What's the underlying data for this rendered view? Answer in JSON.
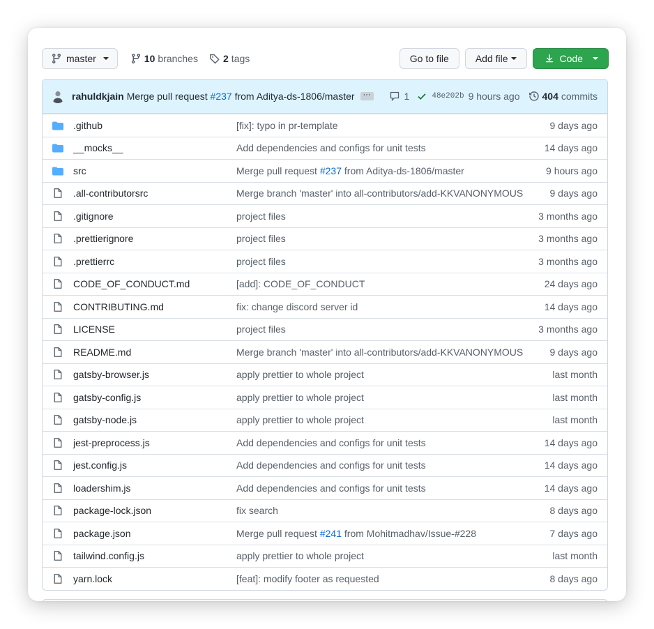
{
  "toolbar": {
    "branch_label": "master",
    "branches_count": "10",
    "branches_label": "branches",
    "tags_count": "2",
    "tags_label": "tags",
    "go_to_file": "Go to file",
    "add_file": "Add file",
    "code": "Code"
  },
  "latest_commit": {
    "author": "rahuldkjain",
    "message_prefix": "Merge pull request",
    "pr": "#237",
    "message_suffix": "from Aditya-ds-1806/master",
    "ellipsis": "···",
    "comments": "1",
    "sha": "48e202b",
    "time": "9 hours ago",
    "commits_count": "404",
    "commits_label": "commits"
  },
  "files": [
    {
      "type": "dir",
      "name": ".github",
      "msg_pre": "[fix]: typo in pr-template",
      "pr": "",
      "msg_post": "",
      "age": "9 days ago"
    },
    {
      "type": "dir",
      "name": "__mocks__",
      "msg_pre": "Add dependencies and configs for unit tests",
      "pr": "",
      "msg_post": "",
      "age": "14 days ago"
    },
    {
      "type": "dir",
      "name": "src",
      "msg_pre": "Merge pull request ",
      "pr": "#237",
      "msg_post": " from Aditya-ds-1806/master",
      "age": "9 hours ago"
    },
    {
      "type": "file",
      "name": ".all-contributorsrc",
      "msg_pre": "Merge branch 'master' into all-contributors/add-KKVANONYMOUS",
      "pr": "",
      "msg_post": "",
      "age": "9 days ago"
    },
    {
      "type": "file",
      "name": ".gitignore",
      "msg_pre": "project files",
      "pr": "",
      "msg_post": "",
      "age": "3 months ago"
    },
    {
      "type": "file",
      "name": ".prettierignore",
      "msg_pre": "project files",
      "pr": "",
      "msg_post": "",
      "age": "3 months ago"
    },
    {
      "type": "file",
      "name": ".prettierrc",
      "msg_pre": "project files",
      "pr": "",
      "msg_post": "",
      "age": "3 months ago"
    },
    {
      "type": "file",
      "name": "CODE_OF_CONDUCT.md",
      "msg_pre": "[add]: CODE_OF_CONDUCT",
      "pr": "",
      "msg_post": "",
      "age": "24 days ago"
    },
    {
      "type": "file",
      "name": "CONTRIBUTING.md",
      "msg_pre": "fix: change discord server id",
      "pr": "",
      "msg_post": "",
      "age": "14 days ago"
    },
    {
      "type": "file",
      "name": "LICENSE",
      "msg_pre": "project files",
      "pr": "",
      "msg_post": "",
      "age": "3 months ago"
    },
    {
      "type": "file",
      "name": "README.md",
      "msg_pre": "Merge branch 'master' into all-contributors/add-KKVANONYMOUS",
      "pr": "",
      "msg_post": "",
      "age": "9 days ago"
    },
    {
      "type": "file",
      "name": "gatsby-browser.js",
      "msg_pre": "apply prettier to whole project",
      "pr": "",
      "msg_post": "",
      "age": "last month"
    },
    {
      "type": "file",
      "name": "gatsby-config.js",
      "msg_pre": "apply prettier to whole project",
      "pr": "",
      "msg_post": "",
      "age": "last month"
    },
    {
      "type": "file",
      "name": "gatsby-node.js",
      "msg_pre": "apply prettier to whole project",
      "pr": "",
      "msg_post": "",
      "age": "last month"
    },
    {
      "type": "file",
      "name": "jest-preprocess.js",
      "msg_pre": "Add dependencies and configs for unit tests",
      "pr": "",
      "msg_post": "",
      "age": "14 days ago"
    },
    {
      "type": "file",
      "name": "jest.config.js",
      "msg_pre": "Add dependencies and configs for unit tests",
      "pr": "",
      "msg_post": "",
      "age": "14 days ago"
    },
    {
      "type": "file",
      "name": "loadershim.js",
      "msg_pre": "Add dependencies and configs for unit tests",
      "pr": "",
      "msg_post": "",
      "age": "14 days ago"
    },
    {
      "type": "file",
      "name": "package-lock.json",
      "msg_pre": "fix search",
      "pr": "",
      "msg_post": "",
      "age": "8 days ago"
    },
    {
      "type": "file",
      "name": "package.json",
      "msg_pre": "Merge pull request ",
      "pr": "#241",
      "msg_post": " from Mohitmadhav/Issue-#228",
      "age": "7 days ago"
    },
    {
      "type": "file",
      "name": "tailwind.config.js",
      "msg_pre": "apply prettier to whole project",
      "pr": "",
      "msg_post": "",
      "age": "last month"
    },
    {
      "type": "file",
      "name": "yarn.lock",
      "msg_pre": "[feat]: modify footer as requested",
      "pr": "",
      "msg_post": "",
      "age": "8 days ago"
    }
  ],
  "colors": {
    "accent": "#0969da",
    "folder": "#54aeff",
    "code_button": "#2da44e",
    "header_bg": "#ddf4ff",
    "check": "#1a7f37"
  },
  "icons": {
    "branch": "git-branch-icon",
    "tag": "tag-icon",
    "download": "download-icon",
    "comment": "comment-icon",
    "check": "check-icon",
    "history": "history-icon",
    "folder": "folder-icon",
    "file": "file-icon"
  }
}
